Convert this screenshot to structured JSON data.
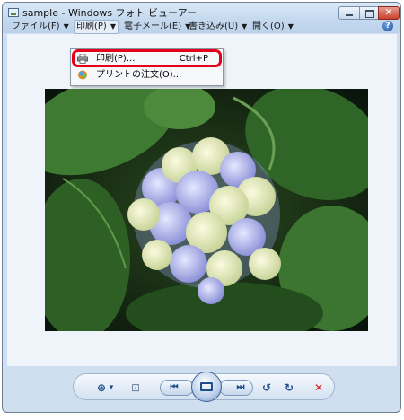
{
  "window": {
    "title": "sample - Windows フォト ビューアー",
    "close_glyph": "✕"
  },
  "menubar": {
    "items": [
      {
        "label": "ファイル(F)"
      },
      {
        "label": "印刷(P)"
      },
      {
        "label": "電子メール(E)"
      },
      {
        "label": "書き込み(U)"
      },
      {
        "label": "開く(O)"
      }
    ],
    "caret": "▼",
    "help": "?"
  },
  "print_menu": {
    "items": [
      {
        "label": "印刷(P)...",
        "shortcut": "Ctrl+P",
        "icon": "printer-icon",
        "highlighted": true
      },
      {
        "label": "プリントの注文(O)...",
        "shortcut": "",
        "icon": "order-prints-icon",
        "highlighted": false
      }
    ],
    "highlight_color": "#e3001b"
  },
  "toolbar": {
    "zoom": "⊕",
    "zoom_caret": "▾",
    "fit": "⊡",
    "previous": "⏮",
    "next": "⏭",
    "rotate_ccw": "↺",
    "rotate_cw": "↻",
    "delete": "✕"
  },
  "photo": {
    "subject": "hydrangea-photo"
  }
}
